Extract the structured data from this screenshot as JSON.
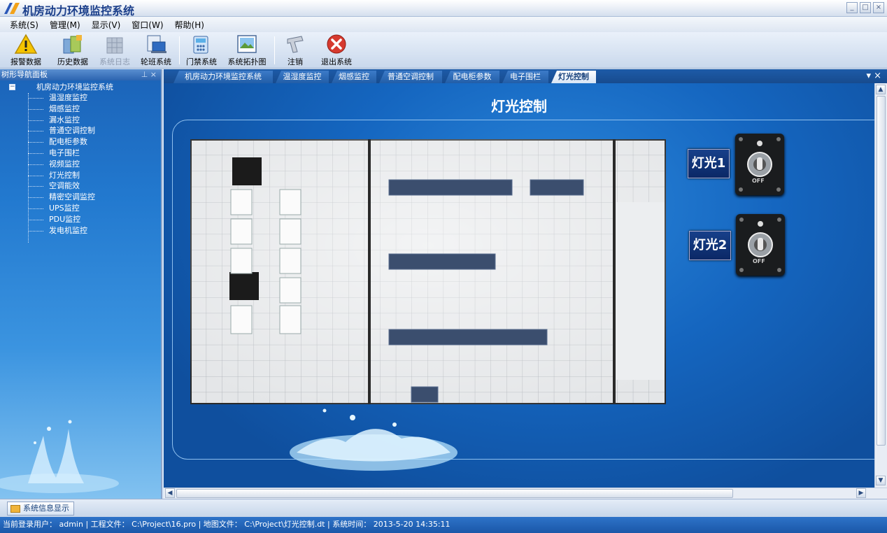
{
  "app": {
    "title": "机房动力环境监控系统"
  },
  "menu": [
    {
      "label": "系统(S)"
    },
    {
      "label": "管理(M)"
    },
    {
      "label": "显示(V)"
    },
    {
      "label": "窗口(W)"
    },
    {
      "label": "帮助(H)"
    }
  ],
  "toolbar": {
    "alarm": "报警数据",
    "history": "历史数据",
    "syslog": "系统日志",
    "shift": "轮班系统",
    "access": "门禁系统",
    "topology": "系统拓扑图",
    "logout": "注销",
    "exit": "退出系统"
  },
  "navpanel": {
    "title": "树形导航面板",
    "root": "机房动力环境监控系统",
    "items": [
      {
        "label": "温湿度监控"
      },
      {
        "label": "烟感监控"
      },
      {
        "label": "漏水监控"
      },
      {
        "label": "普通空调控制"
      },
      {
        "label": "配电柜参数"
      },
      {
        "label": "电子围栏"
      },
      {
        "label": "视频监控"
      },
      {
        "label": "灯光控制"
      },
      {
        "label": "空调能效"
      },
      {
        "label": "精密空调监控"
      },
      {
        "label": "UPS监控"
      },
      {
        "label": "PDU监控"
      },
      {
        "label": "发电机监控"
      }
    ]
  },
  "tabs": [
    {
      "label": "机房动力环境监控系统"
    },
    {
      "label": "温湿度监控"
    },
    {
      "label": "烟感监控"
    },
    {
      "label": "普通空调控制"
    },
    {
      "label": "配电柜参数"
    },
    {
      "label": "电子围栏"
    },
    {
      "label": "灯光控制",
      "active": true
    }
  ],
  "main": {
    "heading": "灯光控制",
    "lights": [
      {
        "label": "灯光1",
        "state": "OFF"
      },
      {
        "label": "灯光2",
        "state": "OFF"
      }
    ]
  },
  "infobar": {
    "tab": "系统信息显示"
  },
  "status": {
    "text": "当前登录用户： admin | 工程文件： C:\\Project\\16.pro | 地图文件： C:\\Project\\灯光控制.dt | 系统时间： 2013-5-20 14:35:11"
  },
  "colors": {
    "accent": "#1566c0",
    "tab_active": "#ffffff",
    "status_bar": "#1a57a8"
  }
}
